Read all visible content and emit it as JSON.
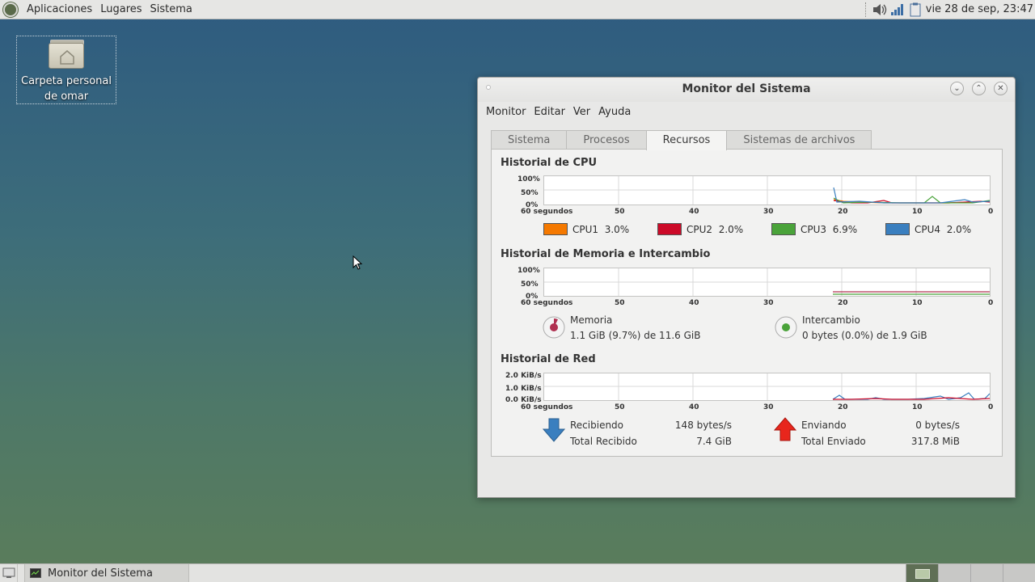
{
  "top_panel": {
    "menus": [
      "Aplicaciones",
      "Lugares",
      "Sistema"
    ],
    "clock": "vie 28 de sep, 23:47"
  },
  "desktop": {
    "icon_label": "Carpeta personal de omar"
  },
  "window": {
    "title": "Monitor del Sistema",
    "menus": [
      "Monitor",
      "Editar",
      "Ver",
      "Ayuda"
    ],
    "tabs": [
      "Sistema",
      "Procesos",
      "Recursos",
      "Sistemas de archivos"
    ],
    "active_tab": "Recursos",
    "cpu": {
      "title": "Historial de CPU",
      "y_labels": [
        "100%",
        "50%",
        "0%"
      ],
      "x_labels": [
        "60 segundos",
        "50",
        "40",
        "30",
        "20",
        "10",
        "0"
      ],
      "legend": [
        {
          "name": "CPU1",
          "value": "3.0%",
          "color": "#f57900"
        },
        {
          "name": "CPU2",
          "value": "2.0%",
          "color": "#cc0a28"
        },
        {
          "name": "CPU3",
          "value": "6.9%",
          "color": "#4aa33a"
        },
        {
          "name": "CPU4",
          "value": "2.0%",
          "color": "#3a7fbf"
        }
      ]
    },
    "memory": {
      "title": "Historial de Memoria e Intercambio",
      "y_labels": [
        "100%",
        "50%",
        "0%"
      ],
      "x_labels": [
        "60 segundos",
        "50",
        "40",
        "30",
        "20",
        "10",
        "0"
      ],
      "mem_label": "Memoria",
      "mem_value": "1.1 GiB (9.7%) de 11.6 GiB",
      "mem_color": "#b03050",
      "swap_label": "Intercambio",
      "swap_value": "0 bytes (0.0%) de 1.9 GiB",
      "swap_color": "#4aa33a"
    },
    "network": {
      "title": "Historial de Red",
      "y_labels": [
        "2.0 KiB/s",
        "1.0 KiB/s",
        "0.0 KiB/s"
      ],
      "x_labels": [
        "60 segundos",
        "50",
        "40",
        "30",
        "20",
        "10",
        "0"
      ],
      "recv_label": "Recibiendo",
      "recv_value": "148 bytes/s",
      "total_recv_label": "Total Recibido",
      "total_recv_value": "7.4 GiB",
      "send_label": "Enviando",
      "send_value": "0 bytes/s",
      "total_send_label": "Total Enviado",
      "total_send_value": "317.8 MiB"
    }
  },
  "taskbar": {
    "task_label": "Monitor del Sistema"
  }
}
